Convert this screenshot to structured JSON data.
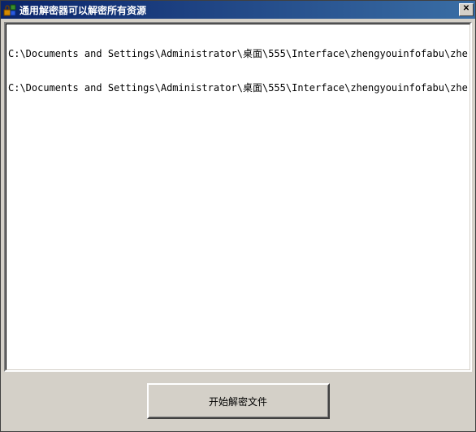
{
  "window": {
    "title": "通用解密器可以解密所有资源",
    "close_glyph": "✕"
  },
  "log": {
    "lines": [
      "C:\\Documents and Settings\\Administrator\\桌面\\555\\Interface\\zhengyouinfofabu\\zhengyouinfofabu.",
      "C:\\Documents and Settings\\Administrator\\桌面\\555\\Interface\\zhengyouinfofabu\\zhengyouinfofabu."
    ]
  },
  "actions": {
    "decrypt_label": "开始解密文件"
  }
}
